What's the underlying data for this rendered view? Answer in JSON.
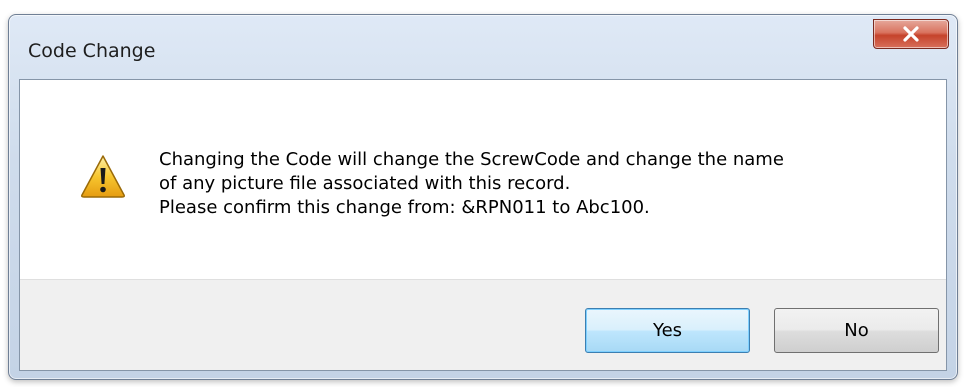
{
  "window": {
    "title": "Code Change"
  },
  "icons": {
    "close": "close-icon",
    "warning": "warning-icon"
  },
  "message": {
    "line1": "Changing the Code will change the ScrewCode and change the name",
    "line2": "of any picture file associated with this record.",
    "line3": "Please confirm this change from: &RPN011 to Abc100."
  },
  "buttons": {
    "yes_label": "Yes",
    "no_label": "No"
  },
  "colors": {
    "close_button": "#c5432b",
    "default_button_border": "#3c7fb1",
    "warning_fill": "#f7c62f"
  }
}
